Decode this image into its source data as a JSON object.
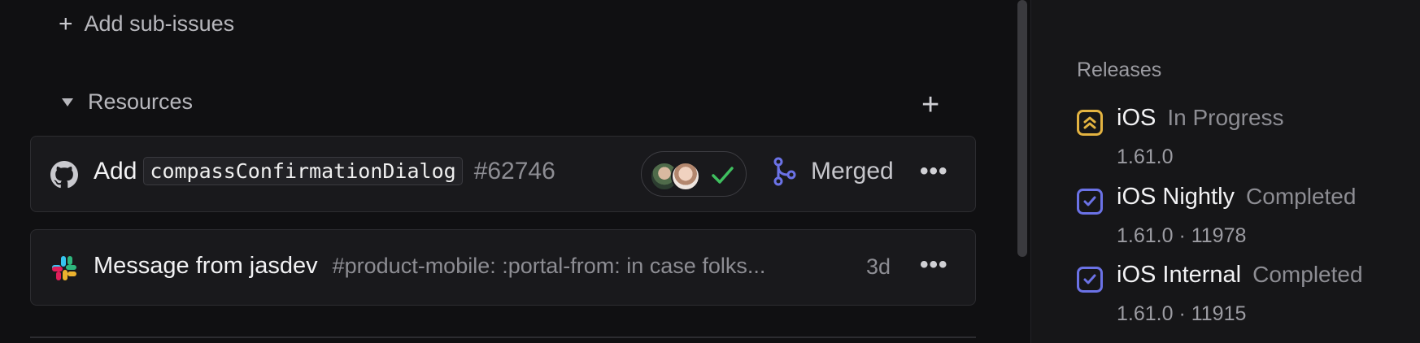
{
  "sub_issues": {
    "add_label": "Add sub-issues"
  },
  "resources": {
    "header": "Resources",
    "items": [
      {
        "type": "pull-request",
        "title_prefix": "Add",
        "title_code": "compassConfirmationDialog",
        "number": "#62746",
        "status": "Merged"
      },
      {
        "type": "slack-message",
        "title": "Message from jasdev",
        "preview": "#product-mobile: :portal-from: in case folks...",
        "age": "3d"
      }
    ]
  },
  "releases": {
    "title": "Releases",
    "items": [
      {
        "name": "iOS",
        "status": "In Progress",
        "version": "1.61.0",
        "icon": "in-progress-icon"
      },
      {
        "name": "iOS Nightly",
        "status": "Completed",
        "version": "1.61.0 · 11978",
        "icon": "completed-icon"
      },
      {
        "name": "iOS Internal",
        "status": "Completed",
        "version": "1.61.0 · 11915",
        "icon": "completed-icon"
      }
    ]
  },
  "colors": {
    "background": "#101012",
    "side_panel": "#161618",
    "card": "#19191c",
    "merged_accent": "#6b72e6",
    "check_green": "#3fbf5f",
    "in_progress_amber": "#e3b341",
    "completed_indigo": "#6b72e6"
  }
}
